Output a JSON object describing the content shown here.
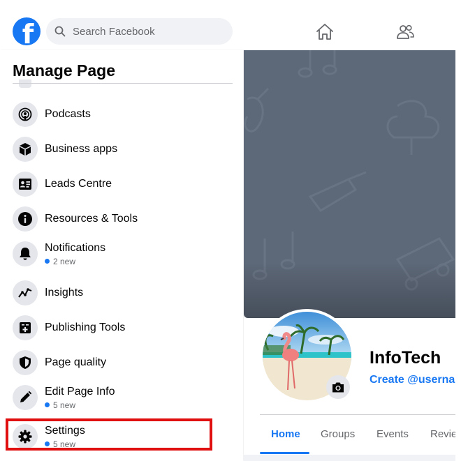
{
  "header": {
    "search_placeholder": "Search Facebook",
    "logo_letter": "f",
    "nav_icons": [
      "home-icon",
      "friends-icon"
    ]
  },
  "sidebar": {
    "title": "Manage Page",
    "items": [
      {
        "label": "Podcasts",
        "icon": "podcast-icon"
      },
      {
        "label": "Business apps",
        "icon": "box-icon"
      },
      {
        "label": "Leads Centre",
        "icon": "id-card-icon"
      },
      {
        "label": "Resources & Tools",
        "icon": "info-icon"
      },
      {
        "label": "Notifications",
        "icon": "bell-icon",
        "badge": "2 new"
      },
      {
        "label": "Insights",
        "icon": "trend-icon"
      },
      {
        "label": "Publishing Tools",
        "icon": "calendar-icon"
      },
      {
        "label": "Page quality",
        "icon": "shield-icon"
      },
      {
        "label": "Edit Page Info",
        "icon": "pencil-icon",
        "badge": "5 new"
      },
      {
        "label": "Settings",
        "icon": "gear-icon",
        "badge": "5 new"
      }
    ]
  },
  "page": {
    "name": "InfoTech",
    "username_link": "Create @userna",
    "tabs": [
      "Home",
      "Groups",
      "Events",
      "Revie"
    ],
    "active_tab": "Home"
  },
  "colors": {
    "brand": "#1877f2",
    "highlight": "#e01010",
    "cover": "#5d6878"
  }
}
